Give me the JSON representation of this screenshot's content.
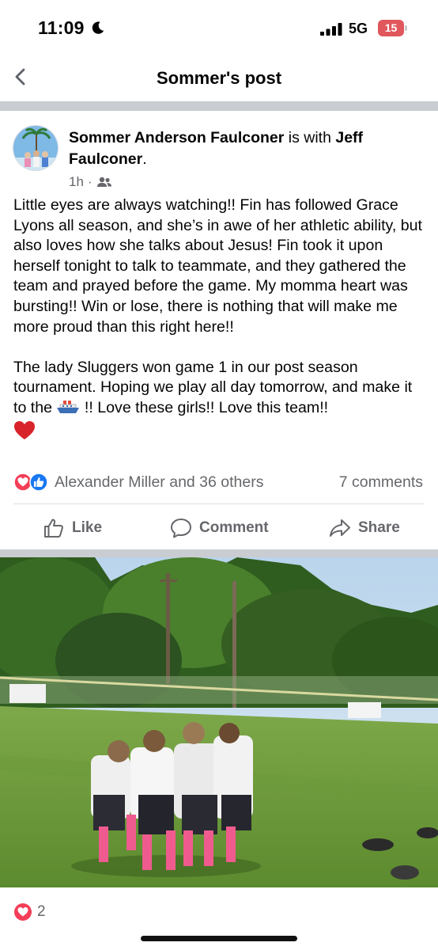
{
  "status_bar": {
    "time": "11:09",
    "network": "5G",
    "battery": "15"
  },
  "header": {
    "title": "Sommer's post"
  },
  "post": {
    "author": "Sommer Anderson Faulconer",
    "with_text": " is with ",
    "tagged": "Jeff Faulconer",
    "tagged_suffix": ".",
    "time": "1h",
    "audience_icon": "friends-icon",
    "body_p1": "Little eyes are always watching!! Fin has followed Grace Lyons all season, and she’s in awe of her athletic ability, but also loves how she talks about Jesus!  Fin took it upon herself tonight to talk to teammate, and they gathered the team and prayed before the game. My momma heart was bursting!! Win or lose, there is nothing that will make me more proud than this right here!!",
    "body_p2a": "The lady Sluggers won game 1 in our post season tournament. Hoping we play all day tomorrow, and make it to the ",
    "body_p2b": " !! Love these girls!! Love this team!!",
    "reactions": {
      "names": "Alexander Miller and 36 others",
      "comments": "7 comments"
    },
    "actions": {
      "like": "Like",
      "comment": "Comment",
      "share": "Share"
    }
  },
  "photo": {
    "reaction_count": "2"
  },
  "colors": {
    "accent_blue": "#1877f2",
    "love_red": "#f33e58",
    "muted_text": "#65676b",
    "divider": "#c9ccd1"
  }
}
